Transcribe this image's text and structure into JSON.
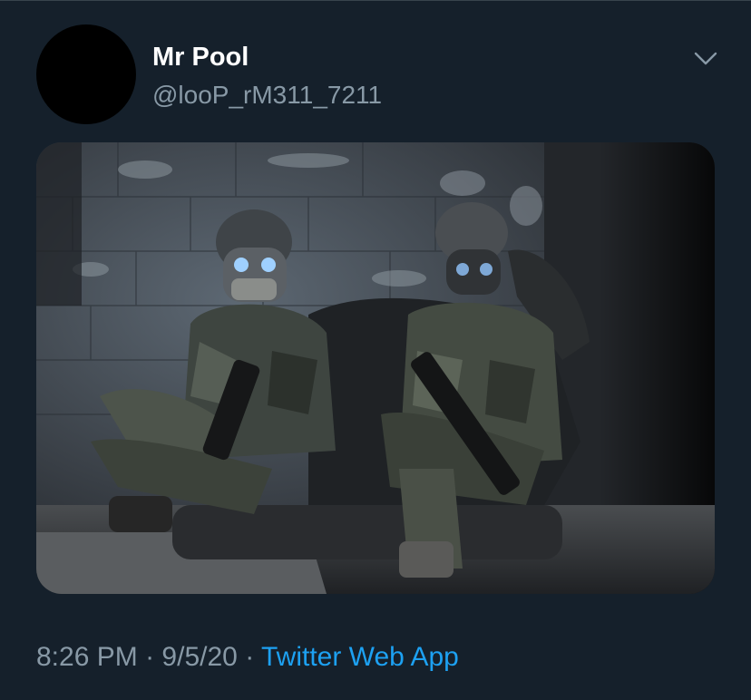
{
  "tweet": {
    "display_name": "Mr Pool",
    "handle": "@looP_rM311_7211",
    "time": "8:26 PM",
    "separator": "·",
    "date": "9/5/20",
    "source": "Twitter Web App"
  },
  "icons": {
    "caret": "chevron-down-icon"
  },
  "colors": {
    "background": "#15202b",
    "muted_text": "#8899a6",
    "link": "#1da1f2",
    "primary_text": "#ffffff"
  }
}
